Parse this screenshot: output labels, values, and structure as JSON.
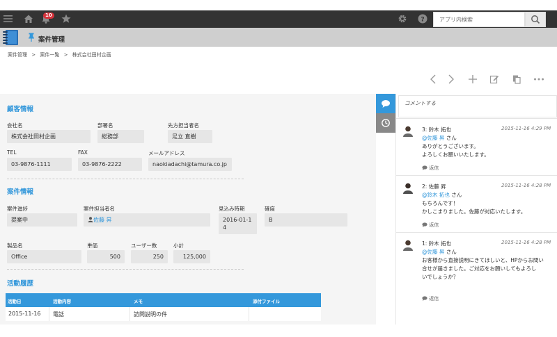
{
  "topbar": {
    "notification_count": "10",
    "search_placeholder": "アプリ内検索"
  },
  "app": {
    "title": "案件管理"
  },
  "breadcrumb": [
    "案件管理",
    ">",
    "案件一覧",
    ">",
    "株式会社田村企画"
  ],
  "customer": {
    "section_title": "顧客情報",
    "company_label": "会社名",
    "company_value": "株式会社田村企画",
    "dept_label": "部署名",
    "dept_value": "総務部",
    "contact_label": "先方担当者名",
    "contact_value": "足立 直樹",
    "tel_label": "TEL",
    "tel_value": "03-9876-1111",
    "fax_label": "FAX",
    "fax_value": "03-9876-2222",
    "mail_label": "メールアドレス",
    "mail_value": "naokiadachi@tamura.co.jp"
  },
  "deal": {
    "section_title": "案件情報",
    "progress_label": "案件進捗",
    "progress_value": "提案中",
    "owner_label": "案件担当者名",
    "owner_value": "佐藤 昇",
    "forecast_label": "見込み時期",
    "forecast_value": "2016-01-14",
    "certainty_label": "確度",
    "certainty_value": "B",
    "product_label": "製品名",
    "product_value": "Office",
    "price_label": "単価",
    "price_value": "500",
    "users_label": "ユーザー数",
    "users_value": "250",
    "subtotal_label": "小計",
    "subtotal_value": "125,000"
  },
  "history": {
    "section_title": "活動履歴",
    "columns": [
      "活動日",
      "活動内容",
      "メモ",
      "添付ファイル"
    ],
    "rows": [
      {
        "date": "2015-11-16",
        "content": "電話",
        "memo": "訪問説明の件",
        "file": ""
      }
    ]
  },
  "comments": {
    "input_placeholder": "コメントする",
    "reply_label": "返信",
    "items": [
      {
        "author": "3: 鈴木 拓也",
        "date": "2015-11-16 4:29 PM",
        "mention": "@佐藤 昇",
        "mention_suffix": " さん",
        "lines": [
          "ありがとうございます。",
          "よろしくお願いいたします。"
        ]
      },
      {
        "author": "2: 佐藤 昇",
        "date": "2015-11-16 4:28 PM",
        "mention": "@鈴木 拓也",
        "mention_suffix": " さん",
        "lines": [
          "もちろんです！",
          "かしこまりました。佐藤が対応いたします。"
        ]
      },
      {
        "author": "1: 鈴木 拓也",
        "date": "2015-11-16 4:28 PM",
        "mention": "@佐藤 昇",
        "mention_suffix": " さん",
        "lines": [
          "お客様から直接説明にきてほしいと、HPからお問い",
          "合せが届きました。ご対応をお願いしてもよろし",
          "いでしょうか？"
        ]
      }
    ]
  },
  "colors": {
    "accent": "#3498db",
    "topbar": "#333333",
    "appbar": "#cfcfcf",
    "badge": "#d6323b"
  }
}
